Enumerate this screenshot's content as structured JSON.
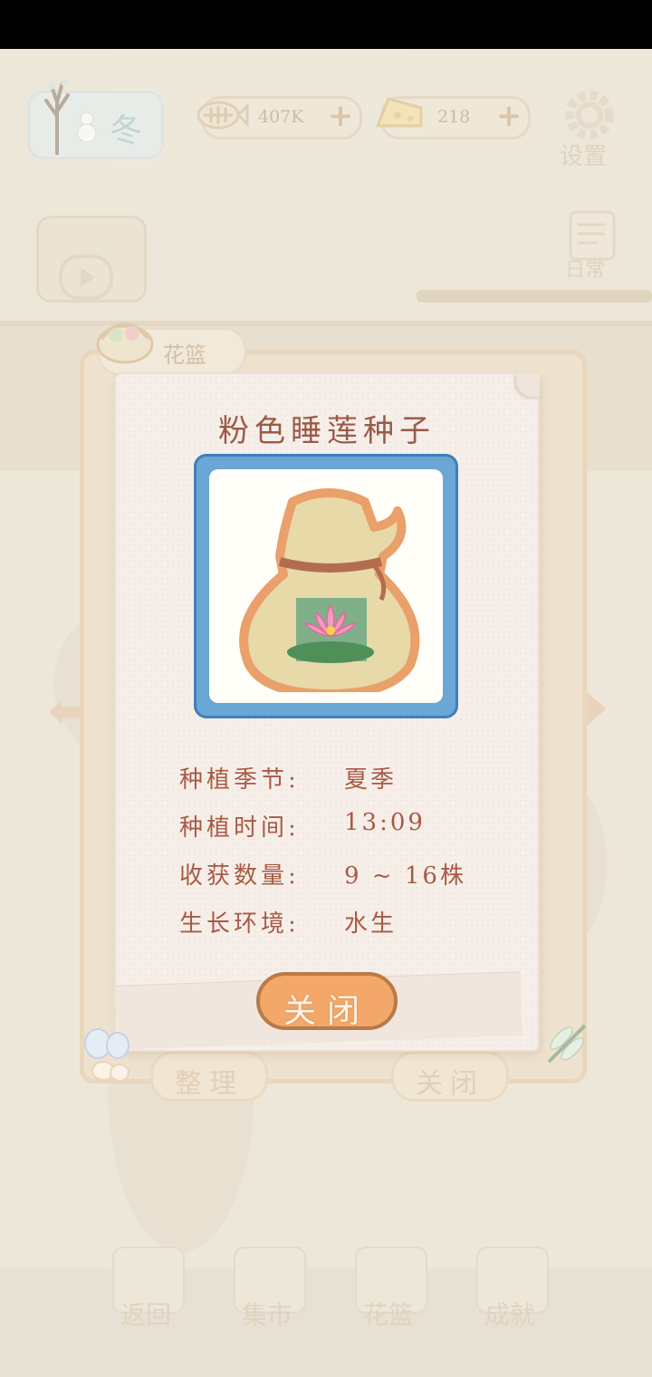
{
  "hud": {
    "season": "冬",
    "fish": "407K",
    "cheese": "218",
    "settings_label": "设置",
    "daily_label": "日常"
  },
  "basket": {
    "tab_label": "花篮",
    "organize_label": "整理",
    "close_label": "关闭"
  },
  "item": {
    "title": "粉色睡莲种子",
    "rows": [
      {
        "label": "种植季节:",
        "value": "夏季"
      },
      {
        "label": "种植时间:",
        "value": "13:09"
      },
      {
        "label": "收获数量:",
        "value": "9 ~ 16株"
      },
      {
        "label": "生长环境:",
        "value": "水生"
      }
    ],
    "close_label": "关闭"
  },
  "bottom_nav": [
    {
      "label": "返回"
    },
    {
      "label": "集市"
    },
    {
      "label": "花篮"
    },
    {
      "label": "成就"
    }
  ],
  "colors": {
    "frame": "#6aa6d6",
    "button": "#f3a869",
    "text": "#a85a44"
  }
}
